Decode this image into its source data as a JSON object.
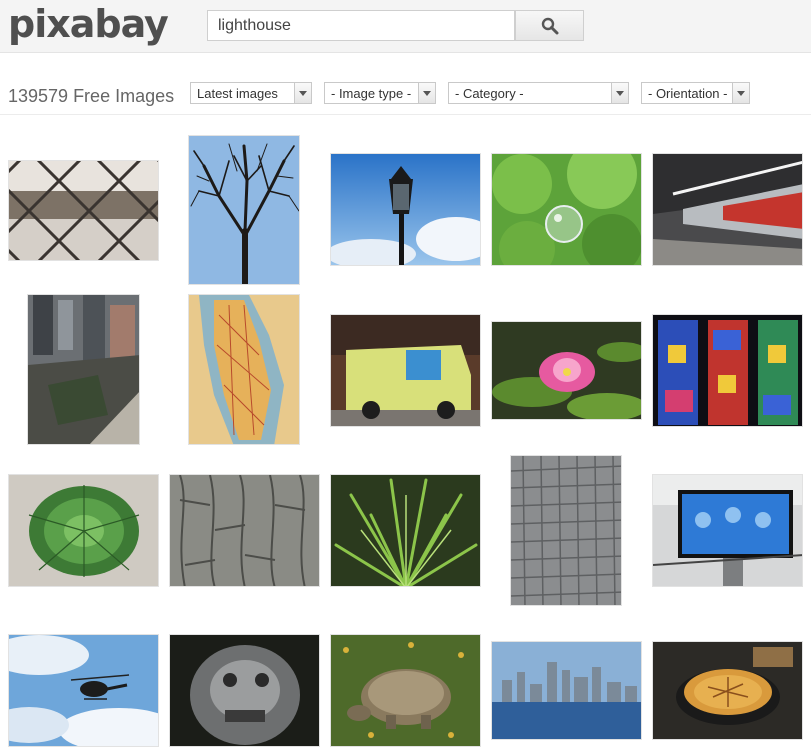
{
  "header": {
    "logo": "pixabay",
    "search": {
      "value": "lighthouse",
      "placeholder": ""
    },
    "search_button_icon": "search-icon"
  },
  "filters": {
    "count_text": "139579 Free Images",
    "sort": "Latest images",
    "image_type": "- Image type -",
    "category": "- Category -",
    "orientation": "- Orientation -"
  },
  "images": [
    {
      "name": "chain-link-fence"
    },
    {
      "name": "bare-tree"
    },
    {
      "name": "street-lamp"
    },
    {
      "name": "soap-bubble"
    },
    {
      "name": "subway-train"
    },
    {
      "name": "city-aerial"
    },
    {
      "name": "manhattan-map"
    },
    {
      "name": "painted-van"
    },
    {
      "name": "water-lily"
    },
    {
      "name": "stained-glass"
    },
    {
      "name": "agave-plant"
    },
    {
      "name": "tree-bark"
    },
    {
      "name": "green-plant"
    },
    {
      "name": "cobblestones"
    },
    {
      "name": "tv-screen"
    },
    {
      "name": "helicopter"
    },
    {
      "name": "lion-statue"
    },
    {
      "name": "tortoise"
    },
    {
      "name": "city-skyline"
    },
    {
      "name": "pie"
    }
  ]
}
